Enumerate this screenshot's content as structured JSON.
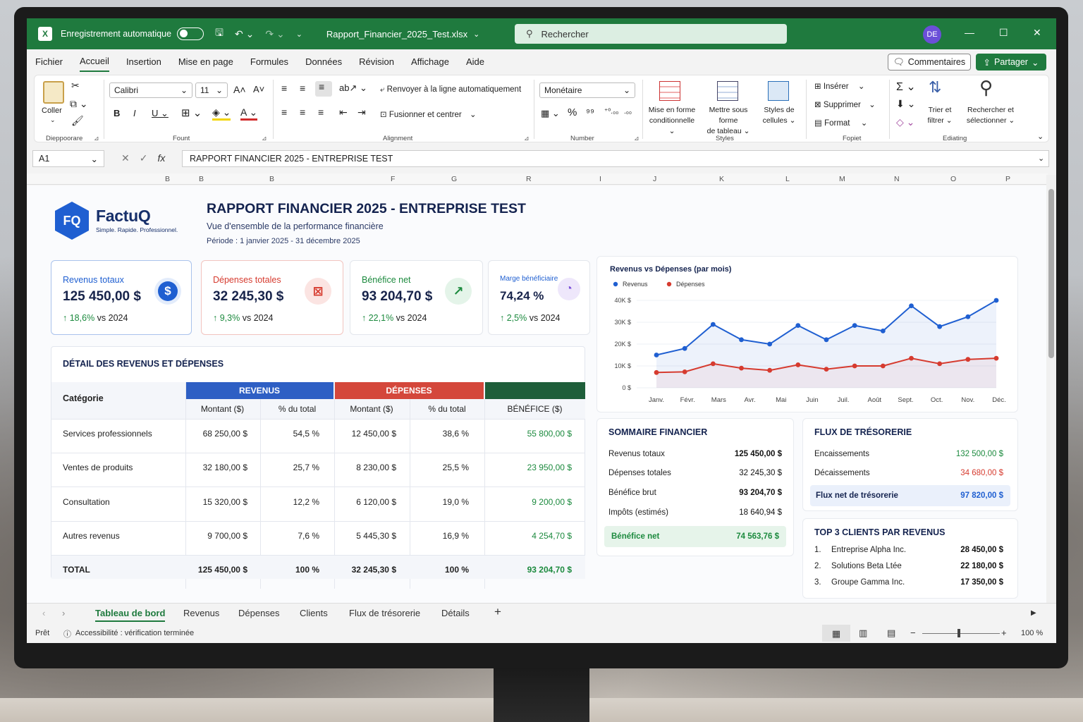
{
  "window": {
    "autosave_label": "Enregistrement automatique",
    "filename": "Rapport_Financier_2025_Test.xlsx",
    "search_placeholder": "Rechercher",
    "user_initials": "DE"
  },
  "menu": [
    "Fichier",
    "Accueil",
    "Insertion",
    "Mise en page",
    "Formules",
    "Données",
    "Révision",
    "Affichage",
    "Aide"
  ],
  "menu_active": "Accueil",
  "actions": {
    "comments": "Commentaires",
    "share": "Partager"
  },
  "ribbon": {
    "paste": "Coller",
    "clipboard_group": "Dieppoorare",
    "font_name": "Calibri",
    "font_size": "11",
    "font_group": "Fount",
    "wrap_text": "Renvoyer à la ligne automatiquement",
    "merge_center": "Fusionner et centrer",
    "alignment_group": "Alignment",
    "number_format": "Monétaire",
    "number_group": "Number",
    "cond_format_1": "Mise en forme",
    "cond_format_2": "conditionnelle",
    "format_table_1": "Mettre sous forme",
    "format_table_2": "de tableau",
    "cell_styles_1": "Styles de",
    "cell_styles_2": "cellules",
    "styles_group": "Styles",
    "insert": "Insérer",
    "delete": "Supprimer",
    "format": "Format",
    "cells_group": "Fopiet",
    "sort_1": "Trier et",
    "sort_2": "filtrer",
    "find_1": "Rechercher et",
    "find_2": "sélectionner",
    "editing_group": "Ediating"
  },
  "formula_bar": {
    "name_box": "A1",
    "content": "RAPPORT FINANCIER 2025 - ENTREPRISE TEST"
  },
  "columns": [
    "B",
    "B",
    "B",
    "F",
    "G",
    "R",
    "I",
    "J",
    "K",
    "L",
    "M",
    "N",
    "O",
    "P"
  ],
  "report": {
    "logo_name": "FactuQ",
    "logo_badge": "FQ",
    "logo_tagline": "Simple. Rapide. Professionnel.",
    "title": "RAPPORT FINANCIER 2025 - ENTREPRISE TEST",
    "subtitle": "Vue d'ensemble de la performance financière",
    "period": "Période : 1 janvier 2025 - 31 décembre 2025"
  },
  "kpis": [
    {
      "label": "Revenus totaux",
      "value": "125 450,00 $",
      "change": "18,6%",
      "suffix": "vs 2024",
      "color": "#1f5fd1"
    },
    {
      "label": "Dépenses totales",
      "value": "32 245,30  $",
      "change": "9,3%",
      "suffix": "vs 2024",
      "color": "#d63b2f"
    },
    {
      "label": "Bénéfice net",
      "value": "93 204,70 $",
      "change": "22,1%",
      "suffix": "vs 2024",
      "color": "#1c8a3e"
    },
    {
      "label": "Marge bénéficiaire",
      "value": "74,24 %",
      "change": "2,5%",
      "suffix": "vs 2024",
      "color": "#7a4fd8"
    }
  ],
  "detail": {
    "title": "DÉTAIL DES REVENUS ET DÉPENSES",
    "cat_header": "Catégorie",
    "group_revenus": "REVENUS",
    "group_depenses": "DÉPENSES",
    "sub_headers": [
      "Montant ($)",
      "% du total",
      "Montant ($)",
      "% du total",
      "BÉNÉFICE ($)"
    ],
    "rows": [
      [
        "Services professionnels",
        "68 250,00 $",
        "54,5 %",
        "12 450,00 $",
        "38,6 %",
        "55 800,00 $"
      ],
      [
        "Ventes de produits",
        "32 180,00 $",
        "25,7 %",
        "8 230,00 $",
        "25,5 %",
        "23 950,00 $"
      ],
      [
        "Consultation",
        "15 320,00 $",
        "12,2 %",
        "6 120,00 $",
        "19,0 %",
        "9 200,00 $"
      ],
      [
        "Autres revenus",
        "9 700,00 $",
        "7,6 %",
        "5 445,30 $",
        "16,9 %",
        "4 254,70 $"
      ]
    ],
    "total": [
      "TOTAL",
      "125 450,00 $",
      "100 %",
      "32 245,30 $",
      "100 %",
      "93 204,70 $"
    ]
  },
  "chart_data": {
    "type": "line",
    "title": "Revenus vs Dépenses (par mois)",
    "categories": [
      "Janv.",
      "Févr.",
      "Mars",
      "Avr.",
      "Mai",
      "Juin",
      "Juil.",
      "Août",
      "Sept.",
      "Oct.",
      "Nov.",
      "Déc."
    ],
    "series": [
      {
        "name": "Revenus",
        "color": "#1f5fd1",
        "values": [
          15000,
          18000,
          29000,
          22000,
          20000,
          28500,
          22000,
          28500,
          26000,
          37500,
          28000,
          32500,
          40000
        ]
      },
      {
        "name": "Dépenses",
        "color": "#d63b2f",
        "values": [
          7000,
          7300,
          11000,
          9000,
          8000,
          10500,
          8500,
          10000,
          10000,
          13500,
          11000,
          13000,
          13500
        ]
      }
    ],
    "y_ticks": [
      "40K $",
      "30K $",
      "20K $",
      "10K $",
      "0 $"
    ],
    "ylim": [
      0,
      40000
    ],
    "legend_position": "top-left",
    "grid": true
  },
  "summary": {
    "title": "SOMMAIRE FINANCIER",
    "rows": [
      [
        "Revenus totaux",
        "125 450,00 $"
      ],
      [
        "Dépenses totales",
        "32 245,30 $"
      ],
      [
        "Bénéfice brut",
        "93 204,70 $"
      ],
      [
        "Impôts (estimés)",
        "18 640,94 $"
      ]
    ],
    "net_label": "Bénéfice net",
    "net_value": "74 563,76 $"
  },
  "cashflow": {
    "title": "FLUX DE TRÉSORERIE",
    "in_label": "Encaissements",
    "in_value": "132 500,00 $",
    "out_label": "Décaissements",
    "out_value": "34 680,00 $",
    "net_label": "Flux net de trésorerie",
    "net_value": "97 820,00 $"
  },
  "top_clients": {
    "title": "TOP 3 CLIENTS PAR REVENUS",
    "rows": [
      [
        "1.",
        "Entreprise Alpha Inc.",
        "28 450,00 $"
      ],
      [
        "2.",
        "Solutions Beta Ltée",
        "22 180,00 $"
      ],
      [
        "3.",
        "Groupe Gamma Inc.",
        "17 350,00 $"
      ]
    ]
  },
  "sheet_tabs": [
    "Tableau de bord",
    "Revenus",
    "Dépenses",
    "Clients",
    "Flux de trésorerie",
    "Détails"
  ],
  "status": {
    "ready": "Prêt",
    "accessibility": "Accessibilité : vérification terminée",
    "zoom": "100 %"
  }
}
